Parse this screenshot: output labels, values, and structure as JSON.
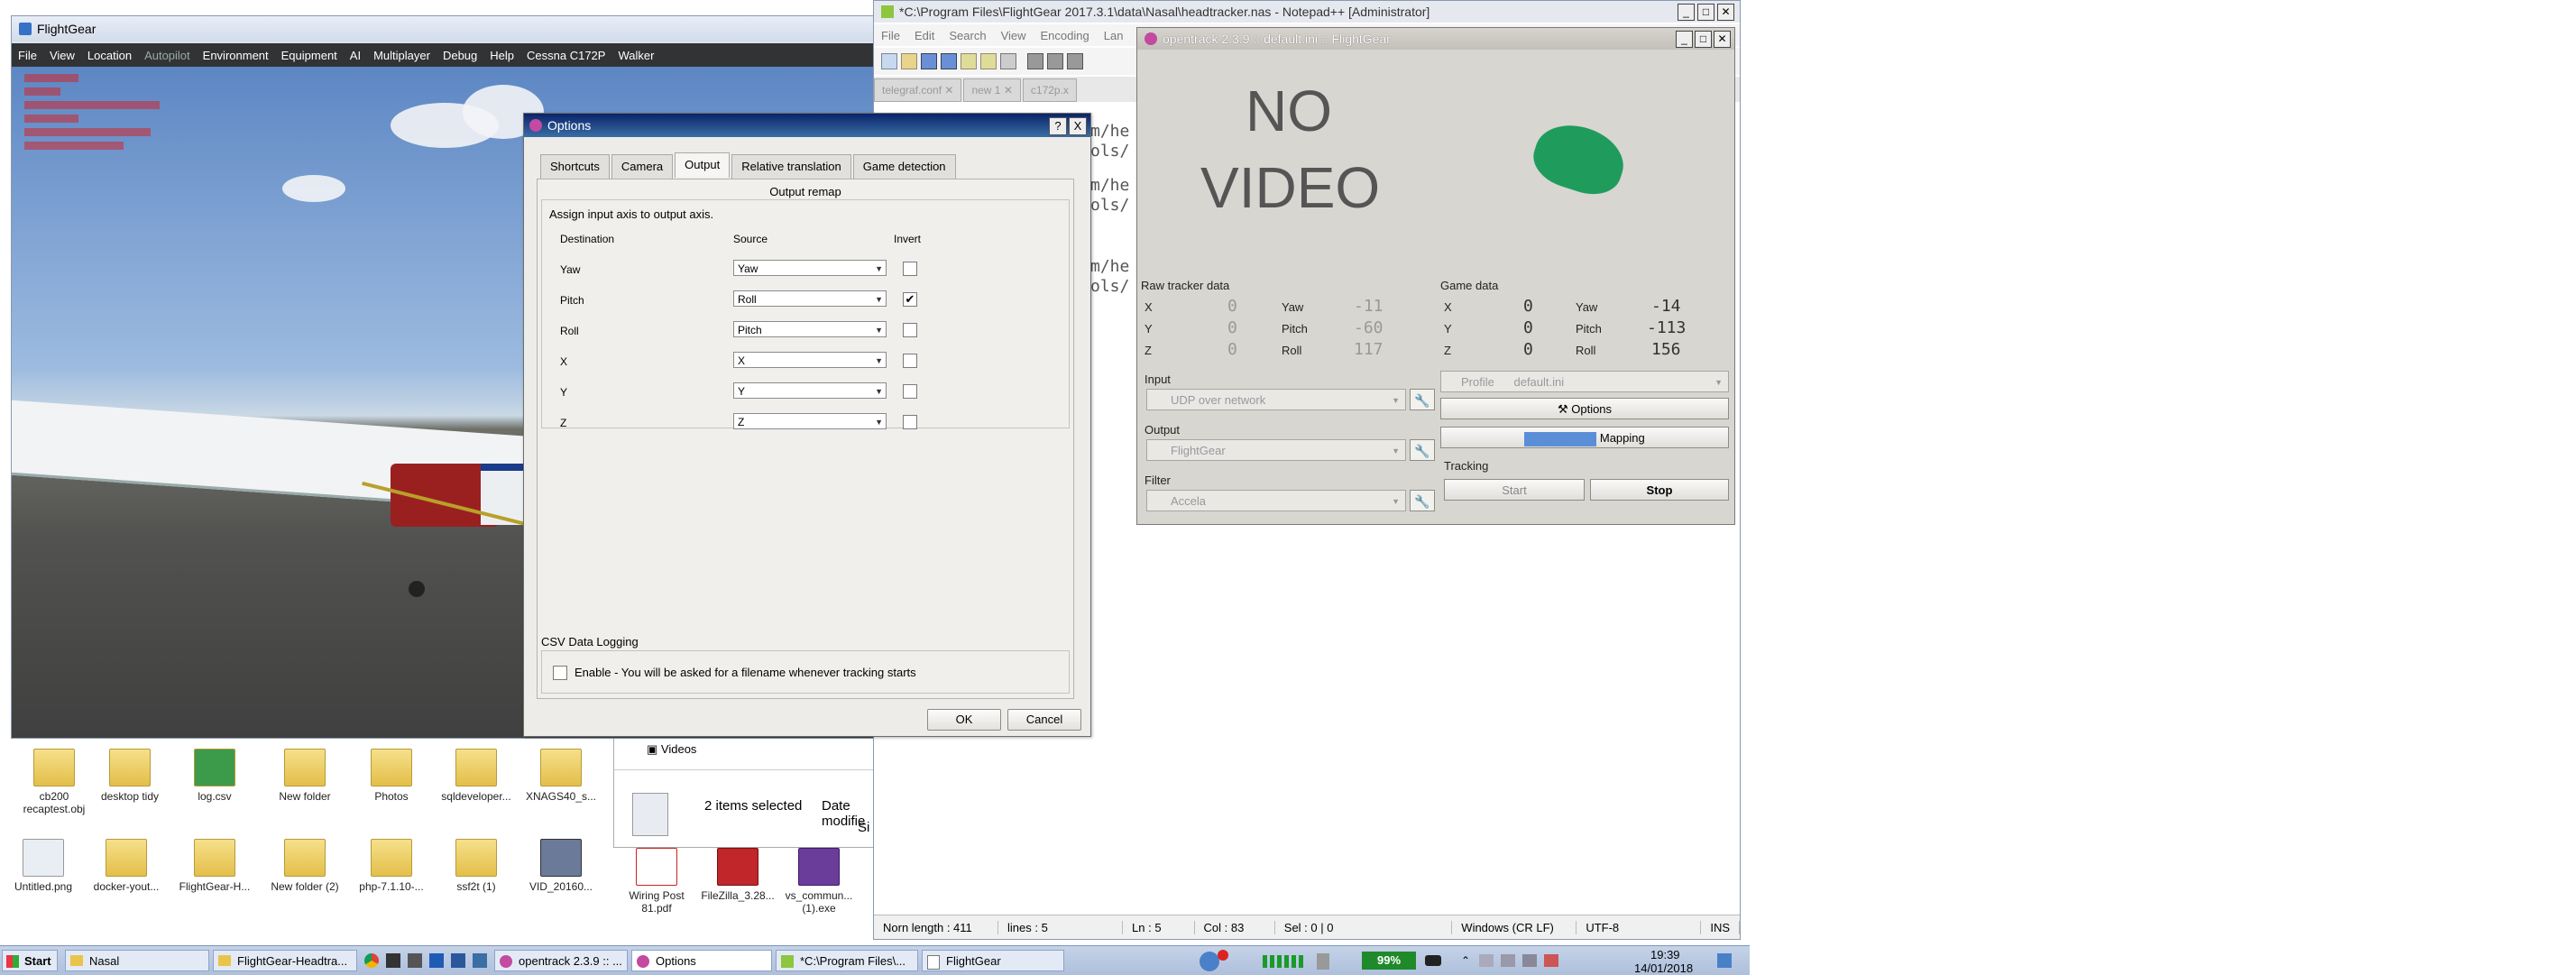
{
  "desktop": {
    "icons": [
      {
        "label": "cb200 recaptest.obj"
      },
      {
        "label": "desktop tidy"
      },
      {
        "label": "log.csv"
      },
      {
        "label": "New folder"
      },
      {
        "label": "Photos"
      },
      {
        "label": "sqldeveloper..."
      },
      {
        "label": "XNAGS40_s..."
      },
      {
        "label": "Untitled.png"
      },
      {
        "label": "docker-yout..."
      },
      {
        "label": "FlightGear-H..."
      },
      {
        "label": "New folder (2)"
      },
      {
        "label": "php-7.1.10-..."
      },
      {
        "label": "ssf2t (1)"
      },
      {
        "label": "VID_20160..."
      },
      {
        "label": "Wiring Post 81.pdf"
      },
      {
        "label": "FileZilla_3.28..."
      },
      {
        "label": "vs_commun... (1).exe"
      }
    ]
  },
  "flightgear": {
    "title": "FlightGear",
    "menu": [
      "File",
      "View",
      "Location",
      "Autopilot",
      "Environment",
      "Equipment",
      "AI",
      "Multiplayer",
      "Debug",
      "Help",
      "Cessna C172P",
      "Walker"
    ]
  },
  "options": {
    "title": "Options",
    "help_btn": "?",
    "close_btn": "X",
    "tabs": [
      "Shortcuts",
      "Camera",
      "Output",
      "Relative translation",
      "Game detection"
    ],
    "active_tab": "Output",
    "remap_title": "Output remap",
    "remap_desc": "Assign input axis to output axis.",
    "col_destination": "Destination",
    "col_source": "Source",
    "col_invert": "Invert",
    "rows": [
      {
        "dest": "Yaw",
        "source": "Yaw",
        "invert": false
      },
      {
        "dest": "Pitch",
        "source": "Roll",
        "invert": true
      },
      {
        "dest": "Roll",
        "source": "Pitch",
        "invert": false
      },
      {
        "dest": "X",
        "source": "X",
        "invert": false
      },
      {
        "dest": "Y",
        "source": "Y",
        "invert": false
      },
      {
        "dest": "Z",
        "source": "Z",
        "invert": false
      }
    ],
    "csv_title": "CSV Data Logging",
    "csv_enable": "Enable - You will be asked for a filename whenever tracking starts",
    "ok": "OK",
    "cancel": "Cancel",
    "check_mark": "✔"
  },
  "notepad": {
    "title": "*C:\\Program Files\\FlightGear 2017.3.1\\data\\Nasal\\headtracker.nas - Notepad++ [Administrator]",
    "menu": [
      "File",
      "Edit",
      "Search",
      "View",
      "Encoding",
      "Lan"
    ],
    "tabs": [
      "telegraf.conf",
      "new 1",
      "c172p.x"
    ],
    "code_lines": [
      "m/he",
      "ols/",
      "m/he",
      "ols/",
      "m/he",
      "ols/"
    ],
    "status": {
      "length": "Norn length : 411",
      "lines": "lines : 5",
      "pos": "Ln : 5",
      "col": "Col : 83",
      "sel": "Sel : 0 | 0",
      "eol": "Windows (CR LF)",
      "encoding": "UTF-8",
      "mode": "INS"
    }
  },
  "opentrack": {
    "title": "opentrack 2.3.9 :: default.ini :: FlightGear",
    "no_video_1": "NO",
    "no_video_2": "VIDEO",
    "raw_title": "Raw tracker data",
    "game_title": "Game data",
    "axis_x": "X",
    "axis_y": "Y",
    "axis_z": "Z",
    "yaw": "Yaw",
    "pitch": "Pitch",
    "roll": "Roll",
    "raw_values": {
      "x": "0",
      "y": "0",
      "z": "0",
      "yaw": "-11",
      "pitch": "-60",
      "roll": "117"
    },
    "game_values": {
      "x": "0",
      "y": "0",
      "z": "0",
      "yaw": "-14",
      "pitch": "-113",
      "roll": "156"
    },
    "input_label": "Input",
    "input_value": "UDP over network",
    "output_label": "Output",
    "output_value": "FlightGear",
    "filter_label": "Filter",
    "filter_value": "Accela",
    "profile_label": "Profile",
    "profile_value": "default.ini",
    "options_btn": "Options",
    "mapping_btn": "Mapping",
    "tracking_label": "Tracking",
    "start_btn": "Start",
    "stop_btn": "Stop"
  },
  "explorer": {
    "item": "Videos",
    "selection": "2 items selected",
    "date_modified": "Date modifie",
    "size": "Si"
  },
  "taskbar": {
    "start": "Start",
    "tasks": [
      "Nasal",
      "FlightGear-Headtra...",
      "opentrack 2.3.9 :: ...",
      "Options",
      "*C:\\Program Files\\...",
      "FlightGear"
    ],
    "battery": "99%",
    "time": "19:39",
    "date": "14/01/2018"
  }
}
